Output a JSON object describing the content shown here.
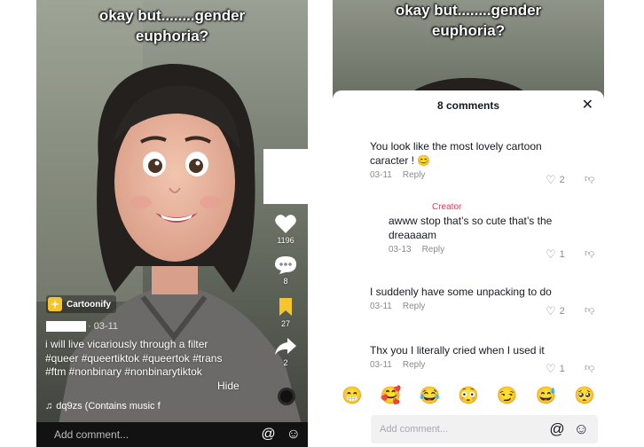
{
  "left_video": {
    "overlay_caption_line1": "okay but........gender",
    "overlay_caption_line2": "euphoria?",
    "likes": "1196",
    "comments": "8",
    "saves": "27",
    "shares": "2",
    "effect_label": "Cartoonify",
    "post_date": "· 03-11",
    "caption_line1": "i will live vicariously through a filter",
    "caption_line2": "#queer #queertiktok #queertok #trans",
    "caption_line3": "#ftm #nonbinary #nonbinarytiktok",
    "hide_label": "Hide",
    "music_text": "dq9zs (Contains music f",
    "comment_placeholder": "Add comment...",
    "mention_icon": "at-sign-icon",
    "emoji_icon": "smiley-icon"
  },
  "right_video": {
    "overlay_caption_line1": "okay but........gender",
    "overlay_caption_line2": "euphoria?",
    "sheet_title": "8 comments",
    "comments": [
      {
        "text_line1": "You look like the most lovely cartoon",
        "text_line2": "caracter ! 😊",
        "date": "03-11",
        "reply": "Reply",
        "likes": "2"
      },
      {
        "tag": "Creator",
        "text_line1": "awww stop that’s so cute that’s the",
        "text_line2": "dreaaaam",
        "date": "03-13",
        "reply": "Reply",
        "likes": "1"
      },
      {
        "text_line1": "I suddenly have some unpacking to do",
        "date": "03-11",
        "reply": "Reply",
        "likes": "2"
      },
      {
        "text_line1": "Thx you I literally cried when I used it",
        "date": "03-11",
        "reply": "Reply",
        "likes": "1"
      }
    ],
    "emojis": [
      "😁",
      "🥰",
      "😂",
      "😳",
      "😏",
      "😅",
      "🥺"
    ],
    "input_placeholder": "Add comment...",
    "mention_icon": "at-sign-icon",
    "emoji_icon": "smiley-icon"
  },
  "colors": {
    "creator": "#fe2c55",
    "secondary_text": "#8a8b91",
    "save_active": "#f7c52b"
  }
}
